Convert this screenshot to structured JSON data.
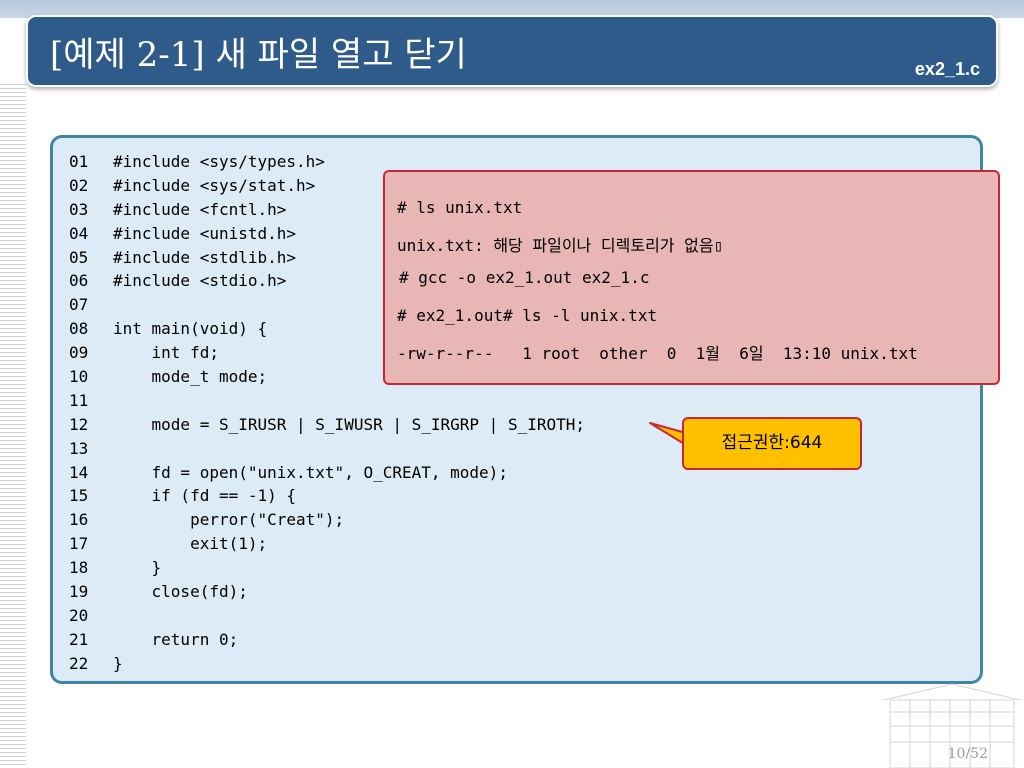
{
  "slide": {
    "title": "[예제 2-1] 새 파일 열고 닫기",
    "file_label": "ex2_1.c",
    "page_number": "10/52"
  },
  "code": {
    "lines": [
      {
        "no": "01",
        "text": "#include <sys/types.h>"
      },
      {
        "no": "02",
        "text": "#include <sys/stat.h>"
      },
      {
        "no": "03",
        "text": "#include <fcntl.h>"
      },
      {
        "no": "04",
        "text": "#include <unistd.h>"
      },
      {
        "no": "05",
        "text": "#include <stdlib.h>"
      },
      {
        "no": "06",
        "text": "#include <stdio.h>"
      },
      {
        "no": "07",
        "text": ""
      },
      {
        "no": "08",
        "text": "int main(void) {"
      },
      {
        "no": "09",
        "text": "    int fd;"
      },
      {
        "no": "10",
        "text": "    mode_t mode;"
      },
      {
        "no": "11",
        "text": ""
      },
      {
        "no": "12",
        "text": "    mode = S_IRUSR | S_IWUSR | S_IRGRP | S_IROTH;"
      },
      {
        "no": "13",
        "text": ""
      },
      {
        "no": "14",
        "text": "    fd = open(\"unix.txt\", O_CREAT, mode);"
      },
      {
        "no": "15",
        "text": "    if (fd == -1) {"
      },
      {
        "no": "16",
        "text": "        perror(\"Creat\");"
      },
      {
        "no": "17",
        "text": "        exit(1);"
      },
      {
        "no": "18",
        "text": "    }"
      },
      {
        "no": "19",
        "text": "    close(fd);"
      },
      {
        "no": "20",
        "text": ""
      },
      {
        "no": "21",
        "text": "    return 0;"
      },
      {
        "no": "22",
        "text": "}"
      }
    ]
  },
  "terminal": {
    "lines": [
      "# ls unix.txt",
      "unix.txt: 해당 파일이나 디렉토리가 없음▯",
      "# gcc -o ex2_1.out ex2_1.c",
      "# ex2_1.out# ls -l unix.txt",
      "-rw-r--r--   1 root  other  0  1월  6일  13:10 unix.txt"
    ]
  },
  "callout": {
    "text": "접근권한:644"
  },
  "colors": {
    "title_bar": "#2f5b8a",
    "code_panel_bg": "#dcebf5",
    "code_panel_border": "#3f86a3",
    "terminal_bg": "#e7b6b5",
    "terminal_border": "#c8273a",
    "callout_bg": "#ffc000"
  }
}
